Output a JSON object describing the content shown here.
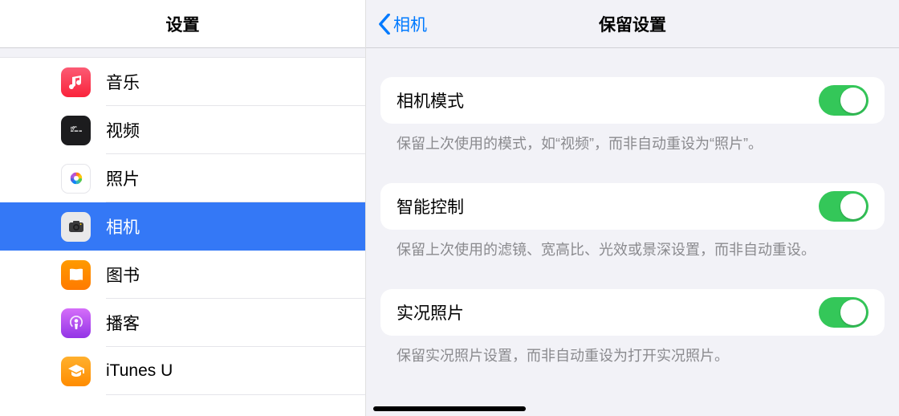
{
  "sidebar": {
    "title": "设置",
    "items": [
      {
        "key": "music",
        "label": "音乐",
        "icon": "music-icon",
        "selected": false
      },
      {
        "key": "video",
        "label": "视频",
        "icon": "video-icon",
        "selected": false
      },
      {
        "key": "photos",
        "label": "照片",
        "icon": "photos-icon",
        "selected": false
      },
      {
        "key": "camera",
        "label": "相机",
        "icon": "camera-icon",
        "selected": true
      },
      {
        "key": "books",
        "label": "图书",
        "icon": "books-icon",
        "selected": false
      },
      {
        "key": "podcast",
        "label": "播客",
        "icon": "podcast-icon",
        "selected": false
      },
      {
        "key": "itunesu",
        "label": "iTunes U",
        "icon": "itunesu-icon",
        "selected": false
      }
    ]
  },
  "detail": {
    "back_label": "相机",
    "title": "保留设置",
    "groups": [
      {
        "label": "相机模式",
        "toggle_on": true,
        "description": "保留上次使用的模式，如“视频”，而非自动重设为“照片”。"
      },
      {
        "label": "智能控制",
        "toggle_on": true,
        "description": "保留上次使用的滤镜、宽高比、光效或景深设置，而非自动重设。"
      },
      {
        "label": "实况照片",
        "toggle_on": true,
        "description": "保留实况照片设置，而非自动重设为打开实况照片。"
      }
    ]
  }
}
